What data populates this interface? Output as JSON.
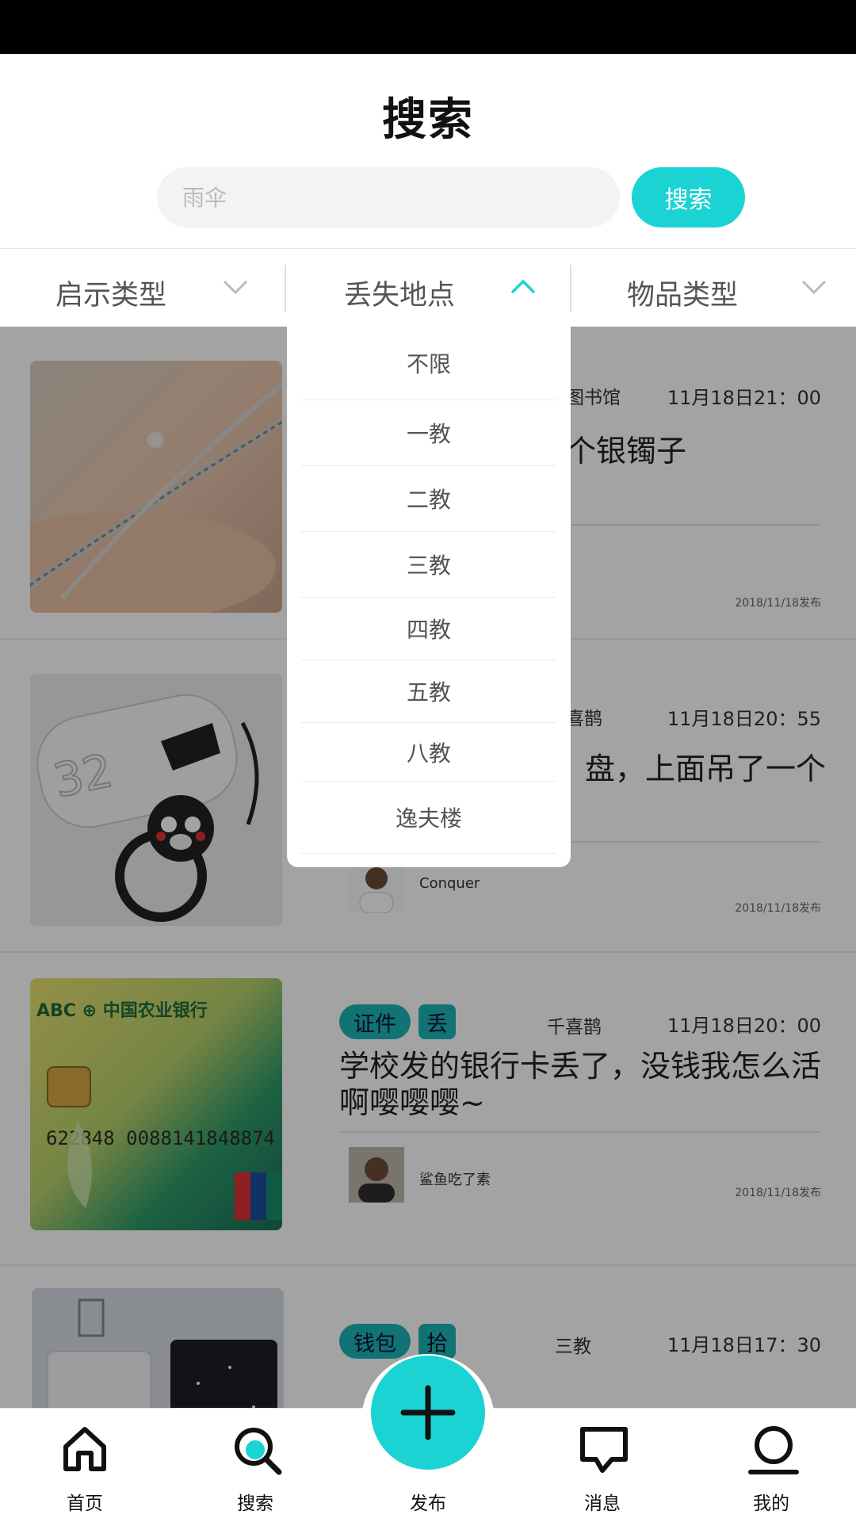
{
  "header": {
    "title": "搜索",
    "search_placeholder": "雨伞",
    "search_button": "搜索"
  },
  "filters": [
    {
      "label": "启示类型",
      "state": "collapsed"
    },
    {
      "label": "丢失地点",
      "state": "expanded"
    },
    {
      "label": "物品类型",
      "state": "collapsed"
    }
  ],
  "dropdown": {
    "items": [
      "不限",
      "一教",
      "二教",
      "三教",
      "四教",
      "五教",
      "八教",
      "逸夫楼"
    ]
  },
  "posts": [
    {
      "category": "",
      "type": "",
      "location": "图书馆",
      "time": "11月18日21：00",
      "title": "个银镯子",
      "author": "",
      "posted": "2018/11/18发布",
      "image": "silver-bracelet"
    },
    {
      "category": "",
      "type": "",
      "location": "喜鹊",
      "time": "11月18日20：55",
      "title": "盘，上面吊了一个",
      "author": "Conquer",
      "posted": "2018/11/18发布",
      "image": "usb-drive"
    },
    {
      "category": "证件",
      "type": "丢",
      "location": "千喜鹊",
      "time": "11月18日20：00",
      "title": "学校发的银行卡丢了，没钱我怎么活啊嘤嘤嘤~",
      "author": "鲨鱼吃了素",
      "posted": "2018/11/18发布",
      "image": "bank-card"
    },
    {
      "category": "钱包",
      "type": "拾",
      "location": "三教",
      "time": "11月18日17：30",
      "title": "",
      "author": "",
      "posted": "",
      "image": "wallet"
    }
  ],
  "tabbar": {
    "items": [
      {
        "label": "首页",
        "icon": "home-icon"
      },
      {
        "label": "搜索",
        "icon": "search-icon"
      },
      {
        "label": "发布",
        "icon": "plus-icon"
      },
      {
        "label": "消息",
        "icon": "message-icon"
      },
      {
        "label": "我的",
        "icon": "profile-icon"
      }
    ]
  },
  "colors": {
    "accent": "#1cd3d3",
    "tag": "#1cb5b5",
    "overlay": "rgba(0,0,0,0.36)"
  }
}
